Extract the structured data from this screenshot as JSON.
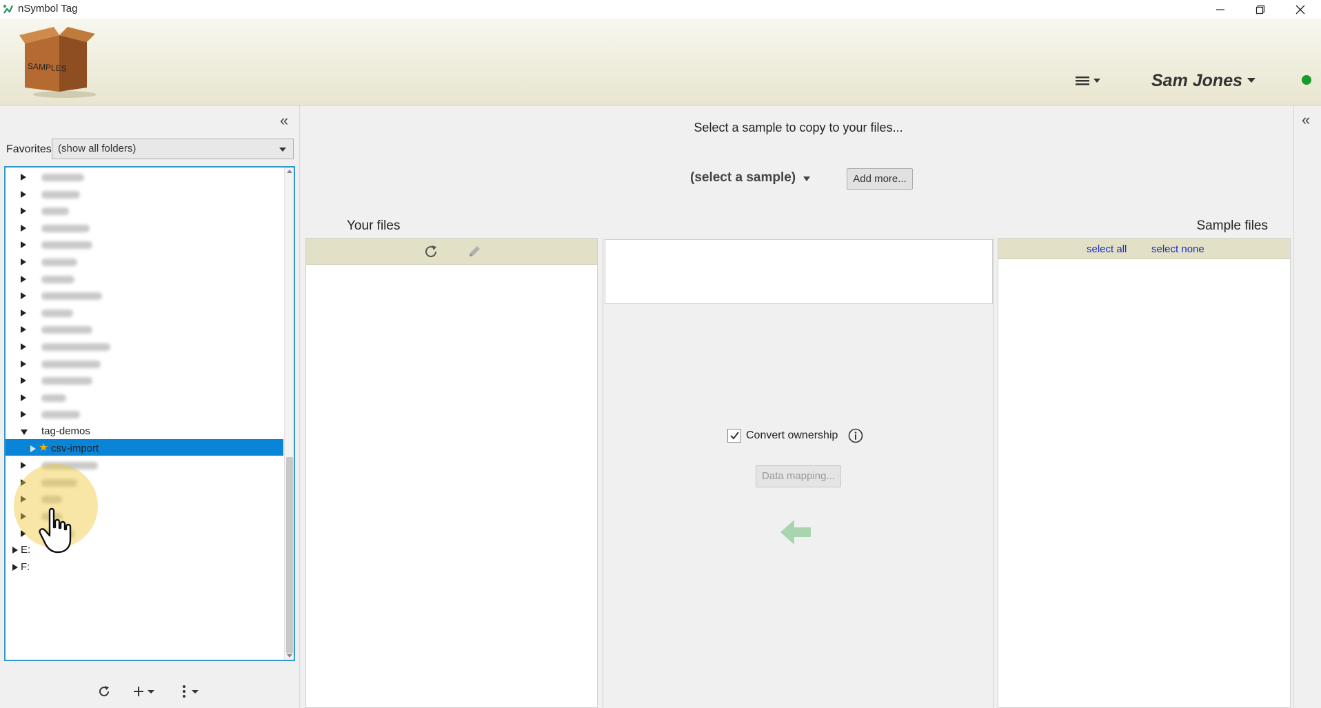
{
  "window": {
    "title": "nSymbol Tag"
  },
  "header": {
    "logo_text": "SAMPLES",
    "user_name": "Sam Jones",
    "status_color": "#1a9a2a",
    "icons": [
      "hamburger-menu-icon",
      "status-online-icon"
    ]
  },
  "left_panel": {
    "favorites_label": "Favorites",
    "favorites_value": "(show all folders)",
    "tree": {
      "items": [
        {
          "label": "",
          "blurred": true,
          "expanded": false,
          "level": 1
        },
        {
          "label": "",
          "blurred": true,
          "expanded": false,
          "level": 1
        },
        {
          "label": "",
          "blurred": true,
          "expanded": false,
          "level": 1
        },
        {
          "label": "",
          "blurred": true,
          "expanded": false,
          "level": 1
        },
        {
          "label": "",
          "blurred": true,
          "expanded": false,
          "level": 1
        },
        {
          "label": "",
          "blurred": true,
          "expanded": false,
          "level": 1
        },
        {
          "label": "",
          "blurred": true,
          "expanded": false,
          "level": 1
        },
        {
          "label": "",
          "blurred": true,
          "expanded": false,
          "level": 1
        },
        {
          "label": "",
          "blurred": true,
          "expanded": false,
          "level": 1
        },
        {
          "label": "",
          "blurred": true,
          "expanded": false,
          "level": 1
        },
        {
          "label": "",
          "blurred": true,
          "expanded": false,
          "level": 1
        },
        {
          "label": "",
          "blurred": true,
          "expanded": false,
          "level": 1
        },
        {
          "label": "",
          "blurred": true,
          "expanded": false,
          "level": 1
        },
        {
          "label": "",
          "blurred": true,
          "expanded": false,
          "level": 1
        },
        {
          "label": "",
          "blurred": true,
          "expanded": false,
          "level": 1
        },
        {
          "label": "tag-demos",
          "blurred": false,
          "expanded": true,
          "level": 1
        },
        {
          "label": "csv-import",
          "blurred": false,
          "expanded": false,
          "level": 2,
          "selected": true,
          "favorite": true
        },
        {
          "label": "",
          "blurred": true,
          "expanded": false,
          "level": 1
        },
        {
          "label": "",
          "blurred": true,
          "expanded": false,
          "level": 1
        },
        {
          "label": "",
          "blurred": true,
          "expanded": false,
          "level": 1
        },
        {
          "label": "",
          "blurred": true,
          "expanded": false,
          "level": 1
        },
        {
          "label": "",
          "blurred": true,
          "expanded": false,
          "level": 1
        },
        {
          "label": "E:",
          "blurred": false,
          "expanded": false,
          "level": 0
        },
        {
          "label": "F:",
          "blurred": false,
          "expanded": false,
          "level": 0
        }
      ]
    },
    "toolbar_icons": [
      "refresh-icon",
      "add-icon",
      "more-options-icon"
    ]
  },
  "main": {
    "instruction": "Select a sample to copy to your files...",
    "sample_select_value": "(select a sample)",
    "add_more_label": "Add more...",
    "your_files_label": "Your files",
    "sample_files_label": "Sample files",
    "select_all_label": "select all",
    "select_none_label": "select none",
    "convert_ownership_label": "Convert ownership",
    "convert_ownership_checked": true,
    "data_mapping_label": "Data mapping...",
    "link_color": "#1a2ec8",
    "selection_color": "#0a84d6"
  }
}
